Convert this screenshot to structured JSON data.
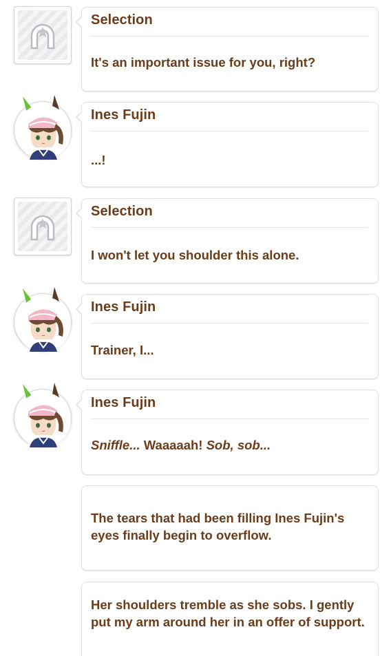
{
  "log": [
    {
      "type": "selection",
      "speaker": "Selection",
      "text": "It's an important issue for you, right?"
    },
    {
      "type": "character",
      "speaker": "Ines Fujin",
      "text": "...!"
    },
    {
      "type": "selection",
      "speaker": "Selection",
      "text": "I won't let you shoulder this alone."
    },
    {
      "type": "character",
      "speaker": "Ines Fujin",
      "text": "Trainer, I..."
    },
    {
      "type": "character",
      "speaker": "Ines Fujin",
      "text_parts": [
        "Sniffle...",
        " Waaaaah! ",
        "Sob, sob..."
      ]
    },
    {
      "type": "narration",
      "text": "The tears that had been filling Ines Fujin's eyes finally begin to overflow."
    },
    {
      "type": "narration",
      "text": "Her shoulders tremble as she sobs. I gently put my arm around her in an offer of support."
    }
  ],
  "colors": {
    "text": "#6b3c1a",
    "bubble_border": "#dcdee2",
    "background": "#ffffff"
  },
  "icons": {
    "selection_avatar": "horseshoe-star-icon",
    "character_avatar": "ines-fujin-portrait"
  }
}
